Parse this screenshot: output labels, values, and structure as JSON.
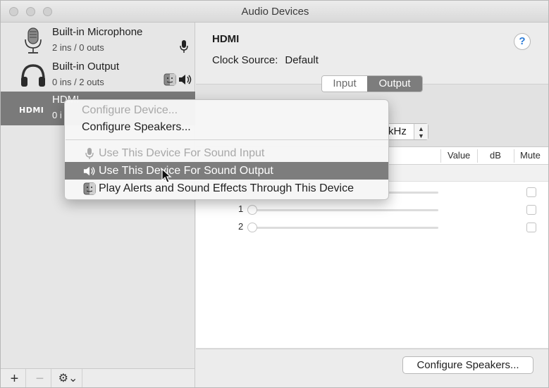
{
  "window": {
    "title": "Audio Devices"
  },
  "sidebar": {
    "devices": [
      {
        "name": "Built-in Microphone",
        "detail": "2 ins / 0 outs",
        "icon": "microphone-icon",
        "right_icon": "microphone-small-icon"
      },
      {
        "name": "Built-in Output",
        "detail": "0 ins / 2 outs",
        "icon": "headphones-icon",
        "right_icon": "speaker-icon"
      },
      {
        "name": "HDMI",
        "detail": "0 i",
        "icon": "hdmi-logo-icon",
        "selected": true
      }
    ],
    "buttons": {
      "add": "+",
      "remove": "−",
      "gear": "⚙︎⌄"
    }
  },
  "detail": {
    "device_name": "HDMI",
    "help": "?",
    "clock_label": "Clock Source:",
    "clock_value": "Default",
    "tabs": [
      {
        "label": "Input",
        "active": false
      },
      {
        "label": "Output",
        "active": true
      }
    ],
    "format_value": "kHz",
    "table": {
      "headers": {
        "value": "Value",
        "db": "dB",
        "mute": "Mute"
      },
      "channels": [
        {
          "label": ""
        },
        {
          "label": "1"
        },
        {
          "label": "2"
        }
      ]
    },
    "configure_button": "Configure Speakers..."
  },
  "context_menu": {
    "items": [
      {
        "label": "Configure Device...",
        "disabled": true
      },
      {
        "label": "Configure Speakers...",
        "disabled": false
      },
      {
        "label": "Use This Device For Sound Input",
        "disabled": true,
        "icon": "microphone-small-icon"
      },
      {
        "label": "Use This Device For Sound Output",
        "disabled": false,
        "highlighted": true,
        "icon": "speaker-icon"
      },
      {
        "label": "Play Alerts and Sound Effects Through This Device",
        "disabled": false,
        "icon": "finder-icon"
      }
    ]
  },
  "colors": {
    "highlight": "#7d7d7d",
    "help_accent": "#2a7ad6"
  }
}
